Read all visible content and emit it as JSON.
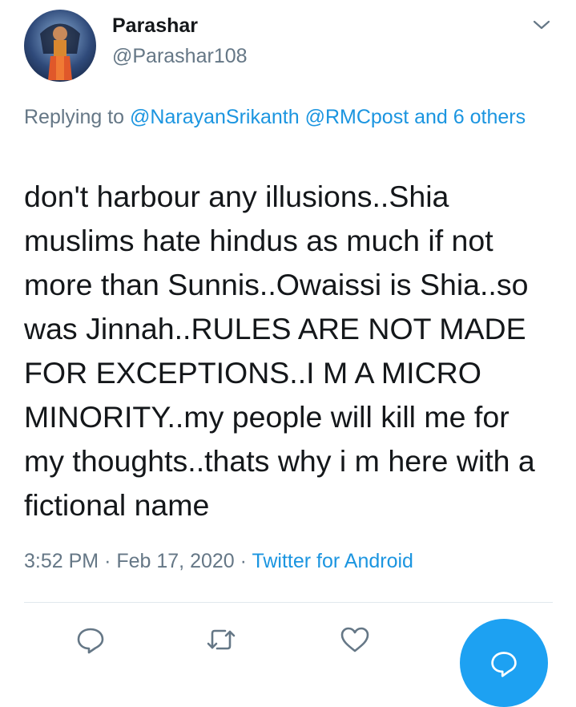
{
  "author": {
    "display_name": "Parashar",
    "handle": "@Parashar108"
  },
  "reply": {
    "prefix": "Replying to ",
    "mention_1": "@NarayanSrikanth",
    "mention_2": "@RMCpost",
    "others": "and 6 others"
  },
  "tweet": {
    "text": "don't harbour any illusions..Shia muslims hate hindus as much if not more than Sunnis..Owaissi is Shia..so was Jinnah..RULES ARE NOT MADE FOR EXCEPTIONS..I M A MICRO MINORITY..my people will kill me for my thoughts..thats why i m here with a fictional name"
  },
  "meta": {
    "time": "3:52 PM",
    "date": "Feb 17, 2020",
    "separator": "·",
    "source": "Twitter for Android"
  },
  "actions": [
    {
      "icon": "reply-icon"
    },
    {
      "icon": "retweet-icon"
    },
    {
      "icon": "like-icon"
    }
  ],
  "colors": {
    "link": "#1b95e0",
    "secondary_text": "#657786",
    "fab": "#1da1f2"
  }
}
